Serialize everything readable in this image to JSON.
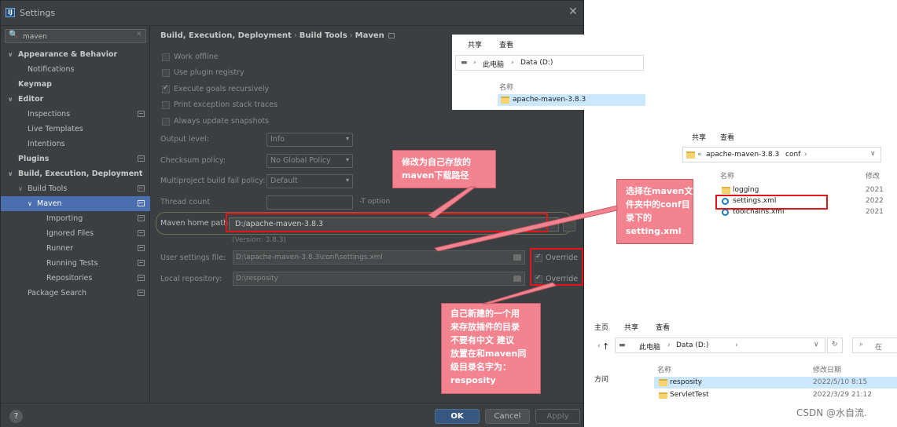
{
  "dialog": {
    "app_icon_letter": "IJ",
    "title": "Settings",
    "close": "✕",
    "search": {
      "value": "maven",
      "icon": "🔍",
      "clear": "✕"
    },
    "tree": [
      {
        "arrow": "∨",
        "label": "Appearance & Behavior"
      },
      {
        "label": "Notifications"
      },
      {
        "label": "Keymap"
      },
      {
        "arrow": "∨",
        "label": "Editor"
      },
      {
        "label": "Inspections"
      },
      {
        "label": "Live Templates"
      },
      {
        "label": "Intentions"
      },
      {
        "label": "Plugins"
      },
      {
        "arrow": "∨",
        "label": "Build, Execution, Deployment"
      },
      {
        "arrow": "∨",
        "label": "Build Tools"
      },
      {
        "arrow": "∨",
        "label": "Maven"
      },
      {
        "label": "Importing"
      },
      {
        "label": "Ignored Files"
      },
      {
        "label": "Runner"
      },
      {
        "label": "Running Tests"
      },
      {
        "label": "Repositories"
      },
      {
        "label": "Package Search"
      }
    ],
    "breadcrumb": [
      "Build, Execution, Deployment",
      "Build Tools",
      "Maven"
    ],
    "breadcrumb_sep": "›",
    "checkboxes": [
      {
        "label": "Work offline",
        "checked": false
      },
      {
        "label": "Use plugin registry",
        "checked": false
      },
      {
        "label": "Execute goals recursively",
        "checked": true
      },
      {
        "label": "Print exception stack traces",
        "checked": false
      },
      {
        "label": "Always update snapshots",
        "checked": false
      }
    ],
    "form": {
      "output_level": {
        "label": "Output level:",
        "value": "Info"
      },
      "checksum_policy": {
        "label": "Checksum policy:",
        "value": "No Global Policy"
      },
      "multiproject_policy": {
        "label": "Multiproject build fail policy:",
        "value": "Default"
      },
      "thread_count": {
        "label": "Thread count",
        "value": "",
        "hint": "-T option"
      },
      "maven_home": {
        "label": "Maven home path:",
        "value": "D:/apache-maven-3.8.3",
        "version": "(Version: 3.8.3)"
      },
      "user_settings": {
        "label": "User settings file:",
        "value": "D:\\apache-maven-3.8.3\\conf\\settings.xml",
        "override": "Override"
      },
      "local_repo": {
        "label": "Local repository:",
        "value": "D:\\resposity",
        "override": "Override"
      },
      "caret": "▾"
    },
    "buttons": {
      "help": "?",
      "ok": "OK",
      "cancel": "Cancel",
      "apply": "Apply"
    }
  },
  "callouts": {
    "maven_path": [
      "修改为自己存放的",
      "maven下载路径"
    ],
    "conf": [
      "选择在maven文",
      "件夹中的conf目",
      "录下的",
      "setting.xml"
    ],
    "repo": [
      "自己新建的一个用",
      "来存放插件的目录",
      "不要有中文 建议",
      "放置在和maven同",
      "级目录名字为：",
      "resposity"
    ]
  },
  "explorer1": {
    "ribbon": [
      "共享",
      "查看"
    ],
    "path": [
      "此电脑",
      "Data (D:)"
    ],
    "column": "名称",
    "item": "apache-maven-3.8.3",
    "sep": "›"
  },
  "explorer2": {
    "ribbon": [
      "共享",
      "查看"
    ],
    "path": [
      "«",
      "apache-maven-3.8.3",
      "›",
      "conf",
      "›"
    ],
    "column_name": "名称",
    "column_modified": "修改",
    "items": [
      {
        "name": "logging",
        "date": "2021"
      },
      {
        "name": "settings.xml",
        "date": "2022"
      },
      {
        "name": "toolchains.xml",
        "date": "2021"
      }
    ]
  },
  "explorer3": {
    "ribbon": [
      "主页",
      "共享",
      "查看"
    ],
    "path": [
      "此电脑",
      "Data (D:)"
    ],
    "nav_up": "↑",
    "nav_chev": "‹",
    "left_label": "方问",
    "column_name": "名称",
    "column_date": "修改日期",
    "search_hint": "在",
    "items": [
      {
        "name": "resposity",
        "date": "2022/5/10 8:15"
      },
      {
        "name": "ServletTest",
        "date": "2022/3/29 21:12"
      }
    ]
  },
  "watermark": "CSDN @水自流.",
  "colors": {
    "accent": "#4b6eaf",
    "ok_button": "#365880",
    "highlight_red": "#e0161b",
    "callout_pink": "#f2838f"
  }
}
